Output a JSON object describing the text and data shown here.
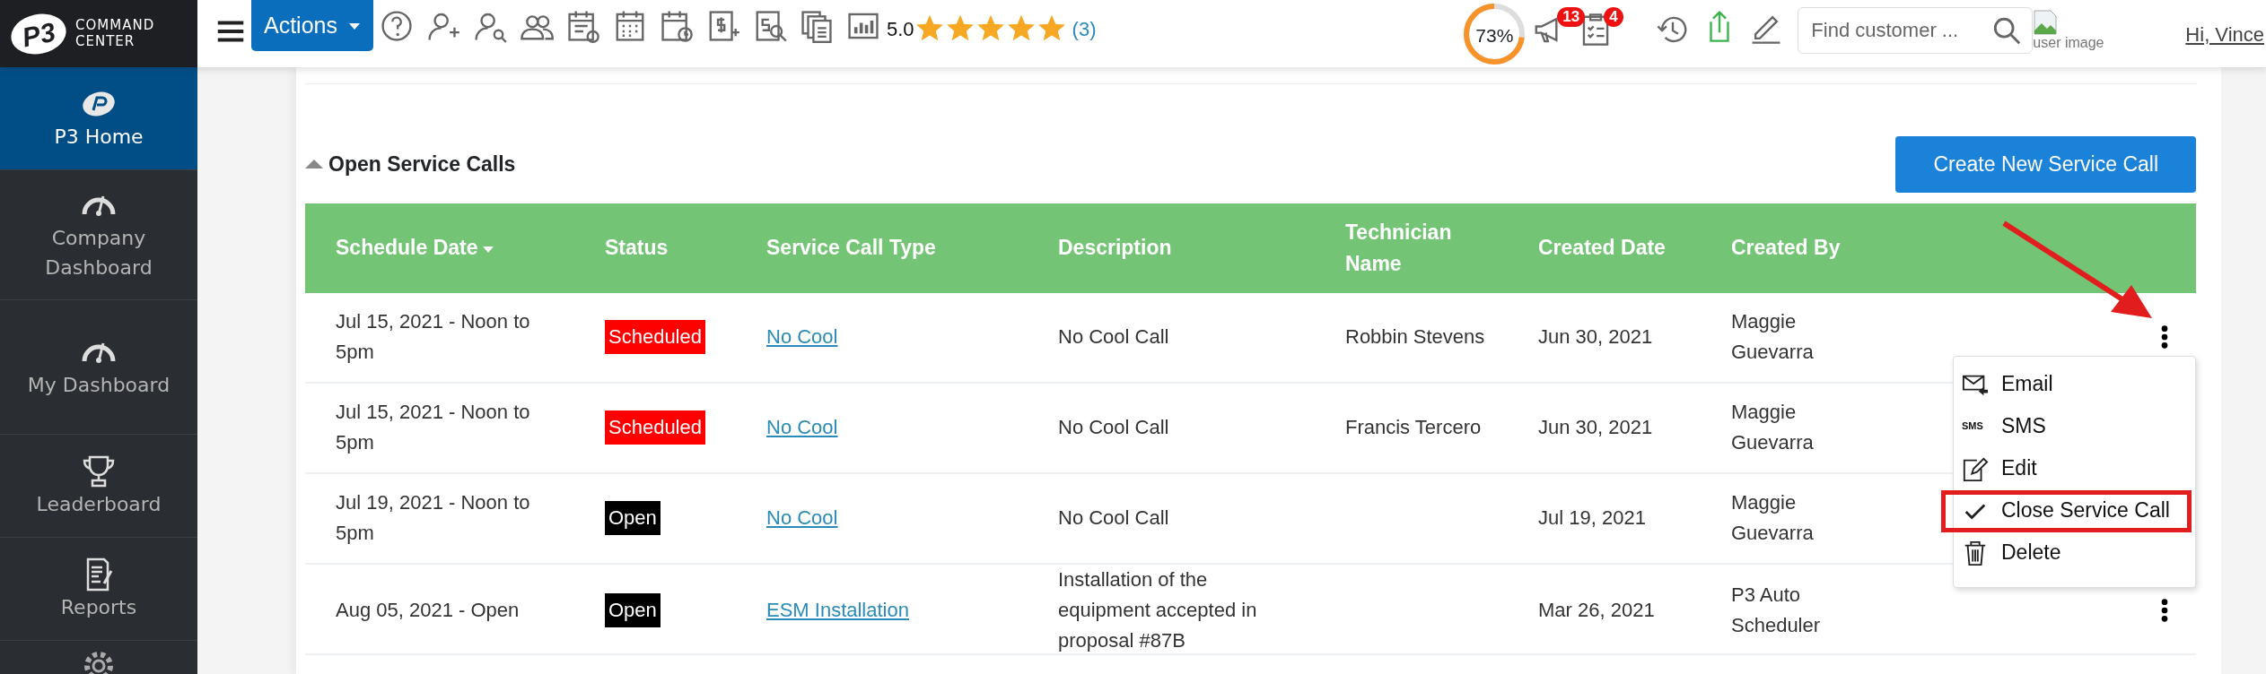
{
  "brand": {
    "logo_text": "P3",
    "line1": "COMMAND",
    "line2": "CENTER"
  },
  "toolbar": {
    "actions_label": "Actions",
    "rating": "5.0",
    "stars": 5,
    "review_count": "(3)"
  },
  "progress": {
    "level": 0.73,
    "reading": "73%"
  },
  "notifications": [
    {
      "count": "13"
    },
    {
      "count": "4"
    }
  ],
  "search": {
    "placeholder": "Find customer ..."
  },
  "user": {
    "image_alt": "user image",
    "greeting": "Hi, Vince"
  },
  "sidebar": {
    "items": [
      {
        "label": "P3 Home",
        "selected": true
      },
      {
        "label": "Company Dashboard",
        "selected": false
      },
      {
        "label": "My Dashboard",
        "selected": false
      },
      {
        "label": "Leaderboard",
        "selected": false
      },
      {
        "label": "Reports",
        "selected": false
      },
      {
        "selected": false
      }
    ]
  },
  "section": {
    "title": "Open Service Calls",
    "expanded": true,
    "create_button": "Create New Service Call"
  },
  "table": {
    "columns": [
      {
        "label": "Schedule Date",
        "sorted": true
      },
      {
        "label": "Status",
        "sorted": false
      },
      {
        "label": "Service Call Type",
        "sorted": false
      },
      {
        "label": "Description",
        "sorted": false
      },
      {
        "label": "Technician Name",
        "sorted": false
      },
      {
        "label": "Created Date",
        "sorted": false
      },
      {
        "label": "Created By",
        "sorted": false
      }
    ],
    "rows": [
      {
        "schedule_date": "Jul 15, 2021 - Noon to 5pm",
        "status": "Scheduled",
        "color": "#ff0000",
        "type": "No Cool",
        "description": "No Cool Call",
        "technician": "Robbin Stevens",
        "created_date": "Jun 30, 2021",
        "created_by": "Maggie Guevarra",
        "actions_visible": true,
        "menu_open": true
      },
      {
        "schedule_date": "Jul 15, 2021 - Noon to 5pm",
        "status": "Scheduled",
        "color": "#ff0000",
        "type": "No Cool",
        "description": "No Cool Call",
        "technician": "Francis Tercero",
        "created_date": "Jun 30, 2021",
        "created_by": "Maggie Guevarra",
        "actions_visible": false,
        "menu_open": false
      },
      {
        "schedule_date": "Jul 19, 2021 - Noon to 5pm",
        "status": "Open",
        "color": "#000000",
        "type": "No Cool",
        "description": "No Cool Call",
        "created_date": "Jul 19, 2021",
        "created_by": "Maggie Guevarra",
        "actions_visible": false,
        "menu_open": false
      },
      {
        "schedule_date": "Aug 05, 2021 - Open",
        "status": "Open",
        "color": "#000000",
        "type": "ESM Installation",
        "description": "Installation of the equipment accepted in proposal #87B",
        "created_date": "Mar 26, 2021",
        "created_by": "P3 Auto Scheduler",
        "actions_visible": true,
        "menu_open": false
      }
    ]
  },
  "row_menu": {
    "items": [
      {
        "label": "Email",
        "highlighted": false
      },
      {
        "label": "SMS",
        "icon_text": "SMS",
        "highlighted": false
      },
      {
        "label": "Edit",
        "highlighted": false
      },
      {
        "label": "Close Service Call",
        "highlighted": true
      },
      {
        "label": "Delete",
        "highlighted": false
      }
    ]
  },
  "annotation": {
    "arrow": true
  }
}
